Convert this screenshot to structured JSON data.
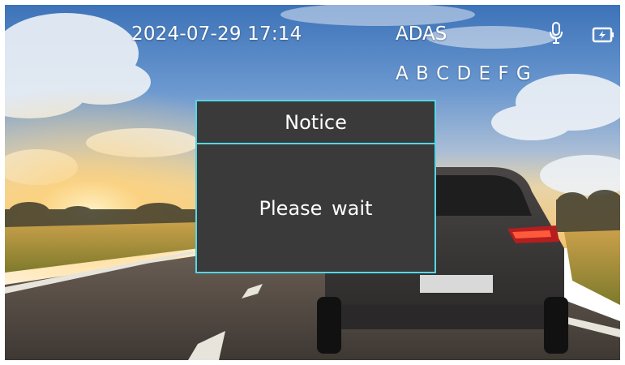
{
  "status_bar": {
    "datetime": "2024-07-29 17:14",
    "mode": "ADAS",
    "icons": [
      "microphone-icon",
      "battery-charging-icon"
    ]
  },
  "adas_indicators": "A B C D E F G",
  "dialog": {
    "title": "Notice",
    "message": "Please wait"
  },
  "colors": {
    "dialog_border": "#55d6e6",
    "dialog_background": "#3a3a3a",
    "text": "#ffffff"
  }
}
